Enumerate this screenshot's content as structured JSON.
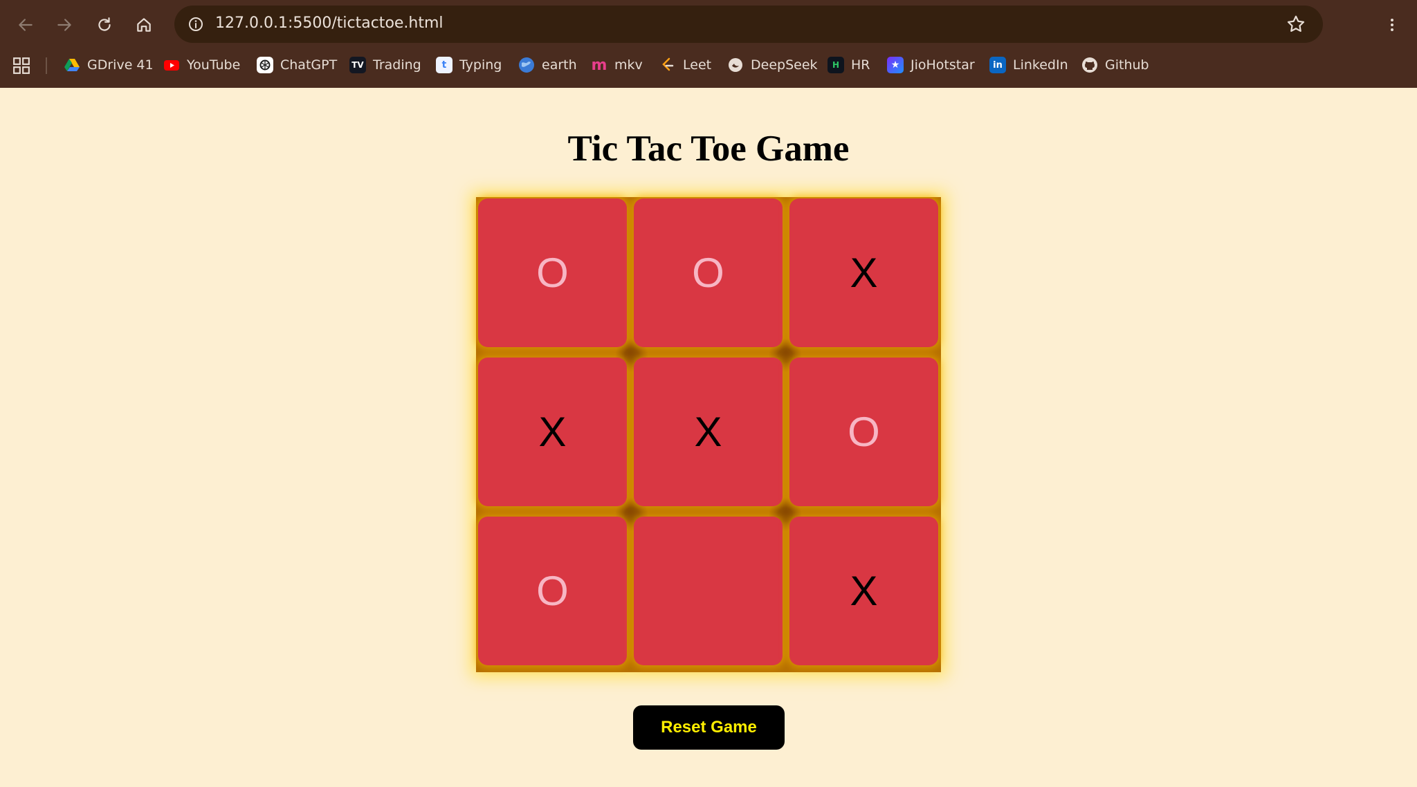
{
  "browser": {
    "url": "127.0.0.1:5500/tictactoe.html",
    "bookmarks": [
      {
        "label": "GDrive 41",
        "icon": "google-drive-icon"
      },
      {
        "label": "YouTube",
        "icon": "youtube-icon"
      },
      {
        "label": "ChatGPT",
        "icon": "chatgpt-icon"
      },
      {
        "label": "Trading",
        "icon": "tradingview-icon"
      },
      {
        "label": "Typing",
        "icon": "typing-icon"
      },
      {
        "label": "earth",
        "icon": "earth-icon"
      },
      {
        "label": "mkv",
        "icon": "mkv-icon"
      },
      {
        "label": "Leet",
        "icon": "leetcode-icon"
      },
      {
        "label": "DeepSeek",
        "icon": "deepseek-icon"
      },
      {
        "label": "HR",
        "icon": "hackerrank-icon"
      },
      {
        "label": "JioHotstar",
        "icon": "jiohotstar-icon"
      },
      {
        "label": "LinkedIn",
        "icon": "linkedin-icon"
      },
      {
        "label": "Github",
        "icon": "github-icon"
      }
    ]
  },
  "page": {
    "title": "Tic Tac Toe Game",
    "reset_label": "Reset Game"
  },
  "board": {
    "cells": [
      "O",
      "O",
      "X",
      "X",
      "X",
      "O",
      "O",
      "",
      "X"
    ]
  },
  "colors": {
    "page_bg": "#fdefd2",
    "chrome_bg": "#4a2c1f",
    "cell_bg": "#d93743",
    "o_mark": "#f7b6c4",
    "x_mark": "#000000",
    "board_gap": "#b77100",
    "board_glow": "#ffe46a",
    "reset_bg": "#000000",
    "reset_text": "#ffee00"
  }
}
